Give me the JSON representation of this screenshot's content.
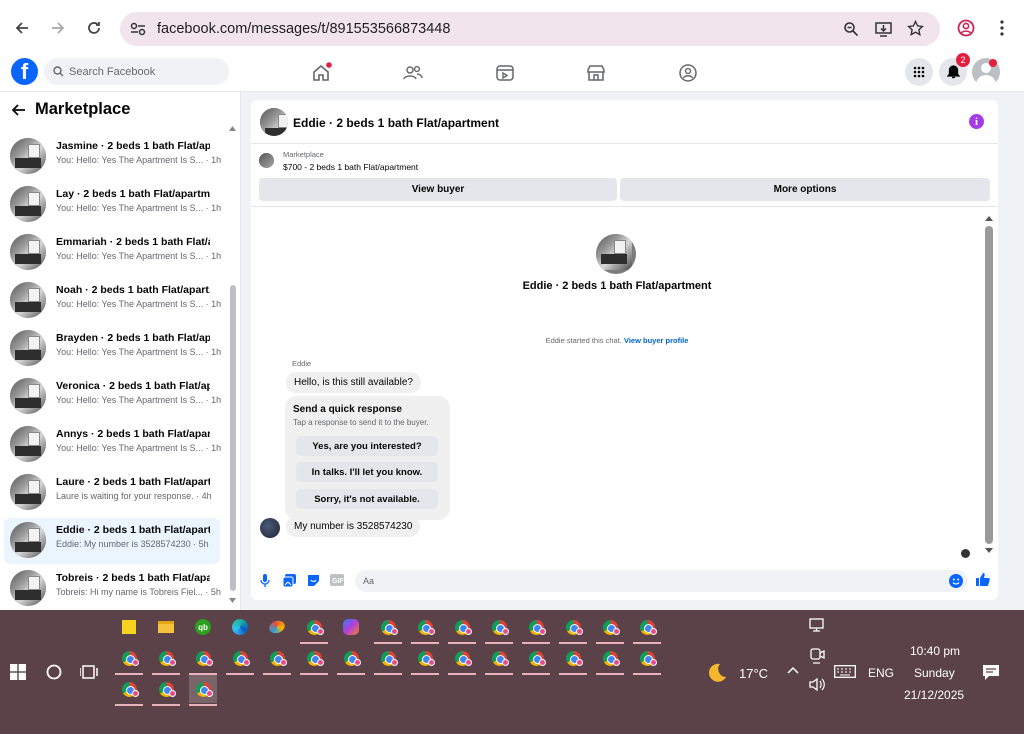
{
  "browser": {
    "url": "facebook.com/messages/t/891553566873448"
  },
  "fb": {
    "search_placeholder": "Search Facebook",
    "notification_count": "2"
  },
  "sidebar": {
    "title": "Marketplace",
    "conversations": [
      {
        "name": "Jasmine · 2 beds 1 bath Flat/ap...",
        "snippet": "You: Hello: Yes The Apartment Is S... · 1h"
      },
      {
        "name": "Lay · 2 beds 1 bath Flat/apartm...",
        "snippet": "You: Hello: Yes The Apartment Is S... · 1h"
      },
      {
        "name": "Emmariah · 2 beds 1 bath Flat/a...",
        "snippet": "You: Hello: Yes The Apartment Is S... · 1h"
      },
      {
        "name": "Noah · 2 beds 1 bath Flat/apart...",
        "snippet": "You: Hello: Yes The Apartment Is S... · 1h"
      },
      {
        "name": "Brayden · 2 beds 1 bath Flat/ap...",
        "snippet": "You: Hello: Yes The Apartment Is S... · 1h"
      },
      {
        "name": "Veronica · 2 beds 1 bath Flat/ap...",
        "snippet": "You: Hello: Yes The Apartment Is S... · 1h"
      },
      {
        "name": "Annys · 2 beds 1 bath Flat/apar...",
        "snippet": "You: Hello: Yes The Apartment Is S... · 1h"
      },
      {
        "name": "Laure · 2 beds 1 bath Flat/apart...",
        "snippet": "Laure is waiting for your response. · 4h"
      },
      {
        "name": "Eddie · 2 beds 1 bath Flat/apart...",
        "snippet": "Eddie: My number is 3528574230 · 5h"
      },
      {
        "name": "Tobreis · 2 beds 1 bath Flat/apa...",
        "snippet": "Tobreis: Hi my name is Tobreis Fiel... · 5h"
      }
    ]
  },
  "chat": {
    "title": "Eddie · 2 beds 1 bath Flat/apartment",
    "listing_source": "Marketplace",
    "listing_price": "$700 - 2 beds 1 bath Flat/apartment",
    "view_buyer": "View buyer",
    "more_options": "More options",
    "profile_name": "Eddie · 2 beds 1 bath Flat/apartment",
    "started_text": "Eddie started this chat.",
    "view_profile": "View buyer profile",
    "sender": "Eddie",
    "msg1": "Hello, is this still available?",
    "quick_title": "Send a quick response",
    "quick_sub": "Tap a response to send it to the buyer.",
    "quick_replies": [
      "Yes, are you interested?",
      "In talks. I'll let you know.",
      "Sorry, it's not available."
    ],
    "msg2": "My number is 3528574230",
    "composer_placeholder": "Aa"
  },
  "taskbar": {
    "weather": "17°C",
    "lang": "ENG",
    "time": "10:40 pm",
    "day": "Sunday",
    "date": "21/12/2025"
  }
}
